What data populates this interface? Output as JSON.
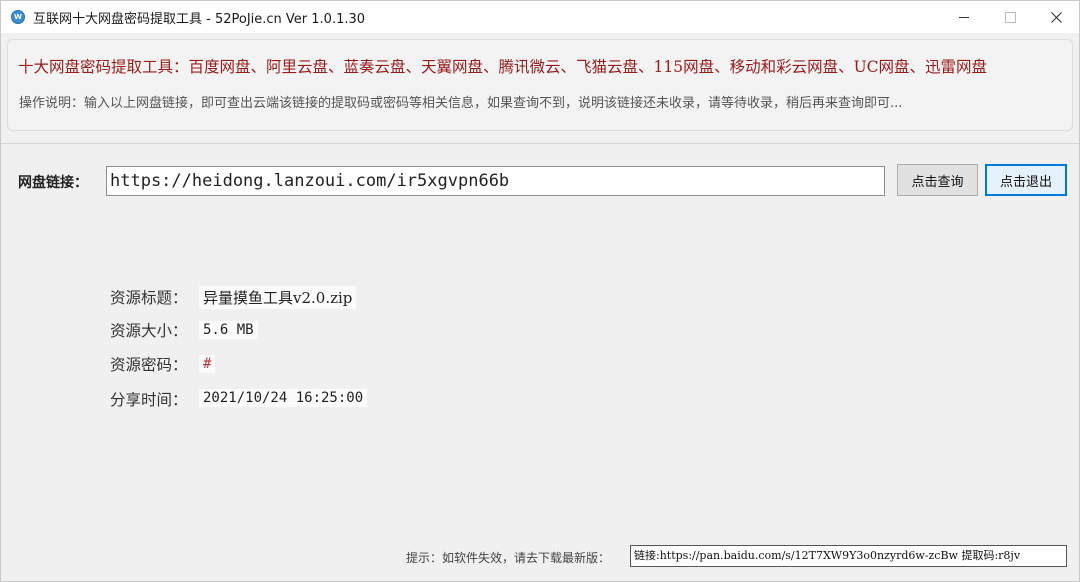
{
  "window": {
    "title": "互联网十大网盘密码提取工具 - 52PoJie.cn  Ver 1.0.1.30",
    "icon_label": "W"
  },
  "header": {
    "supported_drives": "十大网盘密码提取工具：百度网盘、阿里云盘、蓝奏云盘、天翼网盘、腾讯微云、飞猫云盘、115网盘、移动和彩云网盘、UC网盘、迅雷网盘",
    "instructions": "操作说明：输入以上网盘链接，即可查出云端该链接的提取码或密码等相关信息，如果查询不到，说明该链接还未收录，请等待收录，稍后再来查询即可..."
  },
  "search": {
    "label": "网盘链接：",
    "value": "https://heidong.lanzoui.com/ir5xgvpn66b",
    "query_button": "点击查询",
    "exit_button": "点击退出"
  },
  "result": {
    "title_label": "资源标题：",
    "title_value": "异量摸鱼工具v2.0.zip",
    "size_label": "资源大小：",
    "size_value": "5.6 MB",
    "password_label": "资源密码：",
    "password_value": "#",
    "time_label": "分享时间：",
    "time_value": "2021/10/24 16:25:00"
  },
  "footer": {
    "hint": "提示：如软件失效，请去下载最新版：",
    "link": "链接:https://pan.baidu.com/s/12T7XW9Y3o0nzyrd6w-zcBw 提取码:r8jv"
  },
  "colors": {
    "accent": "#0078d7",
    "header_text": "#9a1a1a",
    "password": "#c23030"
  },
  "icons": [
    "app-icon",
    "minimize-icon",
    "maximize-icon",
    "close-icon"
  ]
}
